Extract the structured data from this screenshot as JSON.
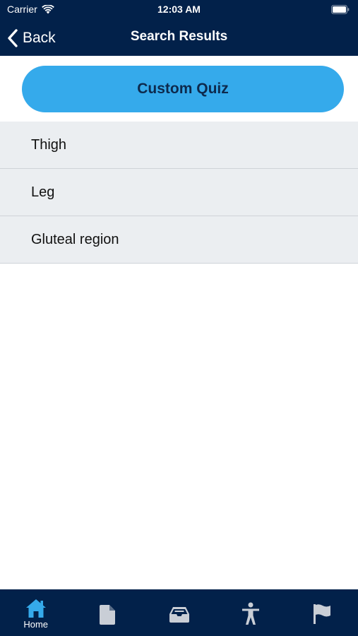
{
  "status_bar": {
    "carrier": "Carrier",
    "time": "12:03 AM",
    "icons": [
      "wifi-icon",
      "battery-icon"
    ]
  },
  "nav": {
    "back_label": "Back",
    "title": "Search Results"
  },
  "custom_quiz": {
    "label": "Custom Quiz"
  },
  "results": [
    {
      "label": "Thigh"
    },
    {
      "label": "Leg"
    },
    {
      "label": "Gluteal region"
    }
  ],
  "tab_bar": {
    "tabs": [
      {
        "icon": "home-icon",
        "label": "Home",
        "selected": true
      },
      {
        "icon": "document-icon",
        "label": ""
      },
      {
        "icon": "inbox-tray-icon",
        "label": ""
      },
      {
        "icon": "person-figure-icon",
        "label": ""
      },
      {
        "icon": "flag-icon",
        "label": ""
      }
    ]
  },
  "colors": {
    "header_background": "#02214a",
    "accent_button": "#35aaeb",
    "selected_tab_icon": "#35aaeb",
    "unselected_tab_icon": "#c9ced6",
    "list_row_background": "#ebeef1"
  }
}
